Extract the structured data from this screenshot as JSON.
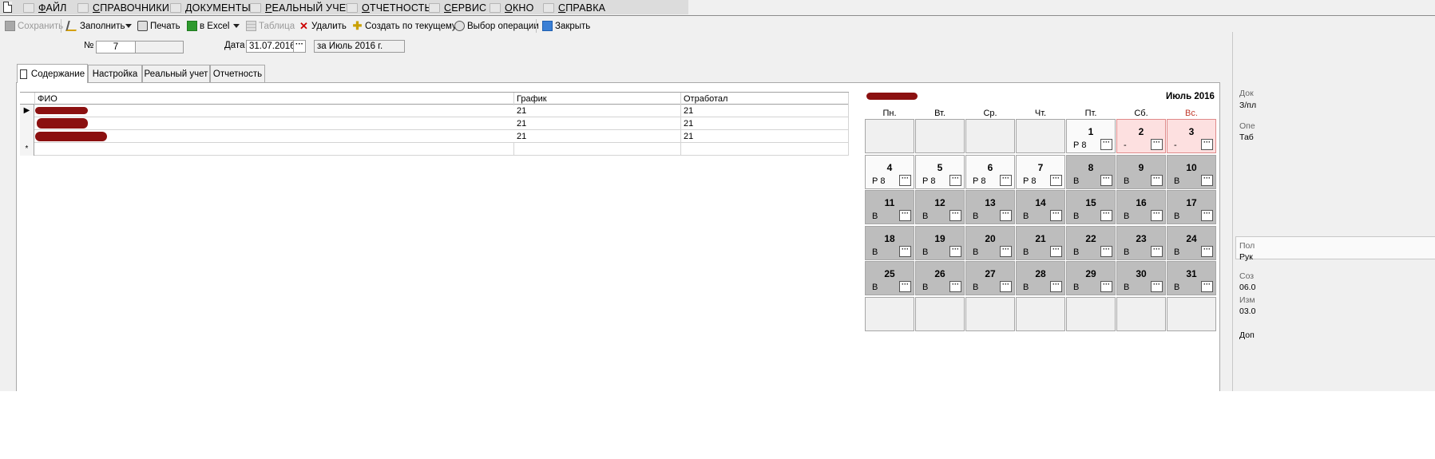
{
  "menu": {
    "items": [
      "ФАЙЛ",
      "СПРАВОЧНИКИ",
      "ДОКУМЕНТЫ",
      "РЕАЛЬНЫЙ УЧЕТ",
      "ОТЧЕТНОСТЬ",
      "СЕРВИС",
      "ОКНО",
      "СПРАВКА"
    ]
  },
  "toolbar": {
    "save": "Сохранить",
    "fill": "Заполнить",
    "print": "Печать",
    "excel": "в Excel",
    "table": "Таблица",
    "delete": "Удалить",
    "create_from_current": "Создать по текущему",
    "choose_operation": "Выбор операции",
    "close": "Закрыть"
  },
  "header": {
    "number_label": "№",
    "number_value": "7",
    "number_suffix": "",
    "date_label": "Дата",
    "date_value": "31.07.2016",
    "period_value": "за Июль 2016 г."
  },
  "tabs": [
    "Содержание",
    "Настройка",
    "Реальный учет",
    "Отчетность"
  ],
  "grid": {
    "columns": [
      "ФИО",
      "График",
      "Отработал"
    ],
    "rows": [
      {
        "schedule": "21",
        "worked": "21"
      },
      {
        "schedule": "21",
        "worked": "21"
      },
      {
        "schedule": "21",
        "worked": "21"
      }
    ],
    "current_row_marker": "▶",
    "new_row_marker": "*"
  },
  "calendar": {
    "month_title": "Июль 2016",
    "weekdays": [
      "Пн.",
      "Вт.",
      "Ср.",
      "Чт.",
      "Пт.",
      "Сб.",
      "Вс."
    ],
    "weeks": [
      [
        null,
        null,
        null,
        null,
        {
          "day": "1",
          "code": "Р 8",
          "kind": "work"
        },
        {
          "day": "2",
          "code": "-",
          "kind": "holiday"
        },
        {
          "day": "3",
          "code": "-",
          "kind": "holiday"
        }
      ],
      [
        {
          "day": "4",
          "code": "Р 8",
          "kind": "work"
        },
        {
          "day": "5",
          "code": "Р 8",
          "kind": "work"
        },
        {
          "day": "6",
          "code": "Р 8",
          "kind": "work"
        },
        {
          "day": "7",
          "code": "Р 8",
          "kind": "work"
        },
        {
          "day": "8",
          "code": "В",
          "kind": "off"
        },
        {
          "day": "9",
          "code": "В",
          "kind": "off"
        },
        {
          "day": "10",
          "code": "В",
          "kind": "off"
        }
      ],
      [
        {
          "day": "11",
          "code": "В",
          "kind": "off"
        },
        {
          "day": "12",
          "code": "В",
          "kind": "off"
        },
        {
          "day": "13",
          "code": "В",
          "kind": "off"
        },
        {
          "day": "14",
          "code": "В",
          "kind": "off"
        },
        {
          "day": "15",
          "code": "В",
          "kind": "off"
        },
        {
          "day": "16",
          "code": "В",
          "kind": "off"
        },
        {
          "day": "17",
          "code": "В",
          "kind": "off"
        }
      ],
      [
        {
          "day": "18",
          "code": "В",
          "kind": "off"
        },
        {
          "day": "19",
          "code": "В",
          "kind": "off"
        },
        {
          "day": "20",
          "code": "В",
          "kind": "off"
        },
        {
          "day": "21",
          "code": "В",
          "kind": "off"
        },
        {
          "day": "22",
          "code": "В",
          "kind": "off"
        },
        {
          "day": "23",
          "code": "В",
          "kind": "off"
        },
        {
          "day": "24",
          "code": "В",
          "kind": "off"
        }
      ],
      [
        {
          "day": "25",
          "code": "В",
          "kind": "off"
        },
        {
          "day": "26",
          "code": "В",
          "kind": "off"
        },
        {
          "day": "27",
          "code": "В",
          "kind": "off"
        },
        {
          "day": "28",
          "code": "В",
          "kind": "off"
        },
        {
          "day": "29",
          "code": "В",
          "kind": "off"
        },
        {
          "day": "30",
          "code": "В",
          "kind": "off"
        },
        {
          "day": "31",
          "code": "В",
          "kind": "off"
        }
      ],
      [
        null,
        null,
        null,
        null,
        null,
        null,
        null
      ]
    ]
  },
  "right_panel": {
    "labels": [
      "Док",
      "З/пл",
      "Опе",
      "Таб",
      "Пол",
      "Рук",
      "Соз",
      "06.0",
      "Изм",
      "03.0",
      "Доп"
    ]
  },
  "colors": {
    "redaction": "#8b1010",
    "holiday_bg": "#fde0e0",
    "off_day_bg": "#bdbdbd",
    "sunday_header": "#c0392b"
  }
}
